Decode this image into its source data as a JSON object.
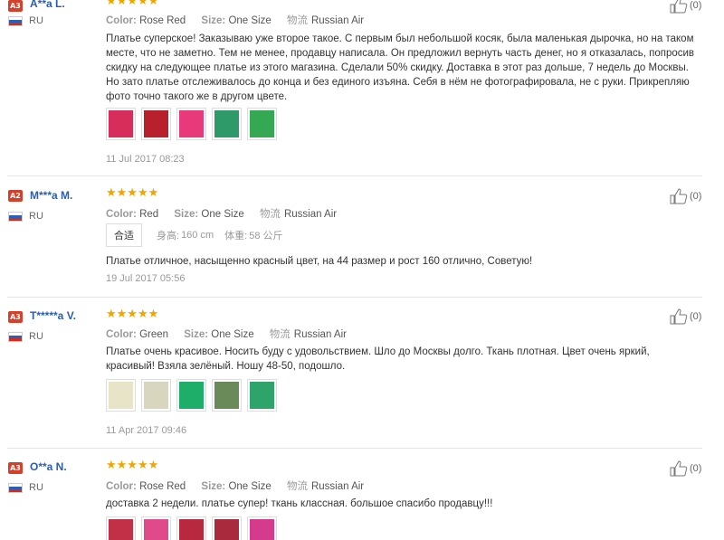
{
  "labels": {
    "color_key": "Color:",
    "size_key": "Size:",
    "ship_key": "物流",
    "height_key": "身高:",
    "weight_key": "体重:",
    "fit_label": "合适"
  },
  "colors": {
    "level_badge": "#d6402b",
    "username": "#2a5db0",
    "stars": "#f0a500"
  },
  "reviews": [
    {
      "level": "A3",
      "user": "A**a L.",
      "country": "RU",
      "stars": "★★★★★",
      "color": "Rose Red",
      "size": "One Size",
      "shipping": "Russian Air",
      "text": "Платье суперское! Заказываю уже второе такое. С первым был небольшой косяк, была маленькая дырочка, но на таком месте, что не заметно. Тем не менее, продавцу написала. Он предложил вернуть часть денег, но я отказалась, попросив скидку на следующее платье из этого магазина. Сделали 50% скидку. Доставка в этот раз дольше, 7 недель до Москвы. Но зато платье отслеживалось до конца и без единого изъяна. Себя в нём не фотографировала, не с руки. Прикрепляю фото точно такого же в другом цвете.",
      "photos": [
        "#d72d5b",
        "#b8202e",
        "#e83a7a",
        "#2e9a6a",
        "#34a853"
      ],
      "date": "11 Jul 2017 08:23",
      "helpful": "(0)"
    },
    {
      "level": "A2",
      "user": "M***a M.",
      "country": "RU",
      "stars": "★★★★★",
      "color": "Red",
      "size": "One Size",
      "shipping": "Russian Air",
      "height": "160 cm",
      "weight": "58 公斤",
      "text": "Платье отличное, насыщенно красный цвет, на 44 размер и рост 160 отлично, Советую!",
      "date": "19 Jul 2017 05:56",
      "helpful": "(0)"
    },
    {
      "level": "A3",
      "user": "T*****a V.",
      "country": "RU",
      "stars": "★★★★★",
      "color": "Green",
      "size": "One Size",
      "shipping": "Russian Air",
      "text": "Платье очень красивое. Носить буду с удовольствием. Шло до Москвы долго. Ткань плотная. Цвет очень яркий, красивый! Взяла зелёный. Ношу 48-50, подошло.",
      "photos": [
        "#e8e4c8",
        "#d9d6c0",
        "#1fae6a",
        "#6b8a5a",
        "#2ea46b"
      ],
      "date": "11 Apr 2017 09:46",
      "helpful": "(0)"
    },
    {
      "level": "A3",
      "user": "O**a N.",
      "country": "RU",
      "stars": "★★★★★",
      "color": "Rose Red",
      "size": "One Size",
      "shipping": "Russian Air",
      "text": "доставка 2 недели. платье супер! ткань классная. большое спасибо продавцу!!!",
      "photos": [
        "#c23048",
        "#e04a8a",
        "#b8283e",
        "#a82a3c",
        "#d63a8c"
      ],
      "helpful": "(0)"
    }
  ]
}
